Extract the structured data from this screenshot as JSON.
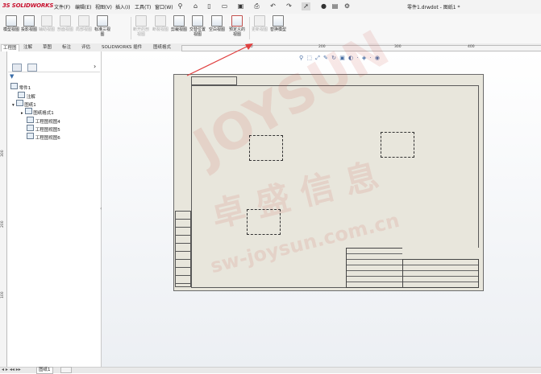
{
  "app": {
    "brand": "SOLIDWORKS",
    "brand_prefix": "3S",
    "document_title": "零件1.drwdot - 图纸1 *"
  },
  "menu": [
    "文件(F)",
    "编辑(E)",
    "视图(V)",
    "插入(I)",
    "工具(T)",
    "窗口(W)"
  ],
  "ribbon": [
    {
      "label": "模型视图",
      "enabled": true,
      "highlight": false
    },
    {
      "label": "投影视图",
      "enabled": true,
      "highlight": false
    },
    {
      "label": "辅助视图",
      "enabled": false,
      "highlight": false
    },
    {
      "label": "剖面视图",
      "enabled": false,
      "highlight": false
    },
    {
      "label": "局部视图",
      "enabled": false,
      "highlight": false
    },
    {
      "label": "标准三视图",
      "enabled": true,
      "highlight": false
    },
    {
      "label": "断开的剖视图",
      "enabled": false,
      "highlight": false
    },
    {
      "label": "断裂视图",
      "enabled": false,
      "highlight": false
    },
    {
      "label": "剪裁视图",
      "enabled": true,
      "highlight": false
    },
    {
      "label": "交替位置视图",
      "enabled": true,
      "highlight": false
    },
    {
      "label": "空白视图",
      "enabled": true,
      "highlight": false
    },
    {
      "label": "预定义的视图",
      "enabled": true,
      "highlight": true
    },
    {
      "label": "更新视图",
      "enabled": false,
      "highlight": false
    },
    {
      "label": "替换模型",
      "enabled": true,
      "highlight": false
    }
  ],
  "tabs": [
    "工程图",
    "注解",
    "草图",
    "标注",
    "评估",
    "SOLIDWORKS 插件",
    "图纸格式"
  ],
  "active_tab": "工程图",
  "ruler": {
    "h_marks": [
      "100",
      "200",
      "300",
      "400"
    ],
    "v_marks": [
      "300",
      "200",
      "100"
    ]
  },
  "tree": {
    "root": "零件1",
    "items": [
      {
        "label": "注解",
        "indent": 1
      },
      {
        "label": "图纸1",
        "indent": 1
      },
      {
        "label": "图纸格式1",
        "indent": 2
      },
      {
        "label": "工程图视图4",
        "indent": 2
      },
      {
        "label": "工程图视图5",
        "indent": 2
      },
      {
        "label": "工程图视图6",
        "indent": 2
      }
    ]
  },
  "status": {
    "sheet_tab": "图纸1"
  },
  "watermark": {
    "cn": "卓 盛 信 息",
    "en": "sw-joysun.com.cn",
    "logo": "JOYSUN"
  },
  "colors": {
    "accent_red": "#c8102e",
    "sheet_bg": "#e8e6dc",
    "arrow": "#e04040"
  }
}
